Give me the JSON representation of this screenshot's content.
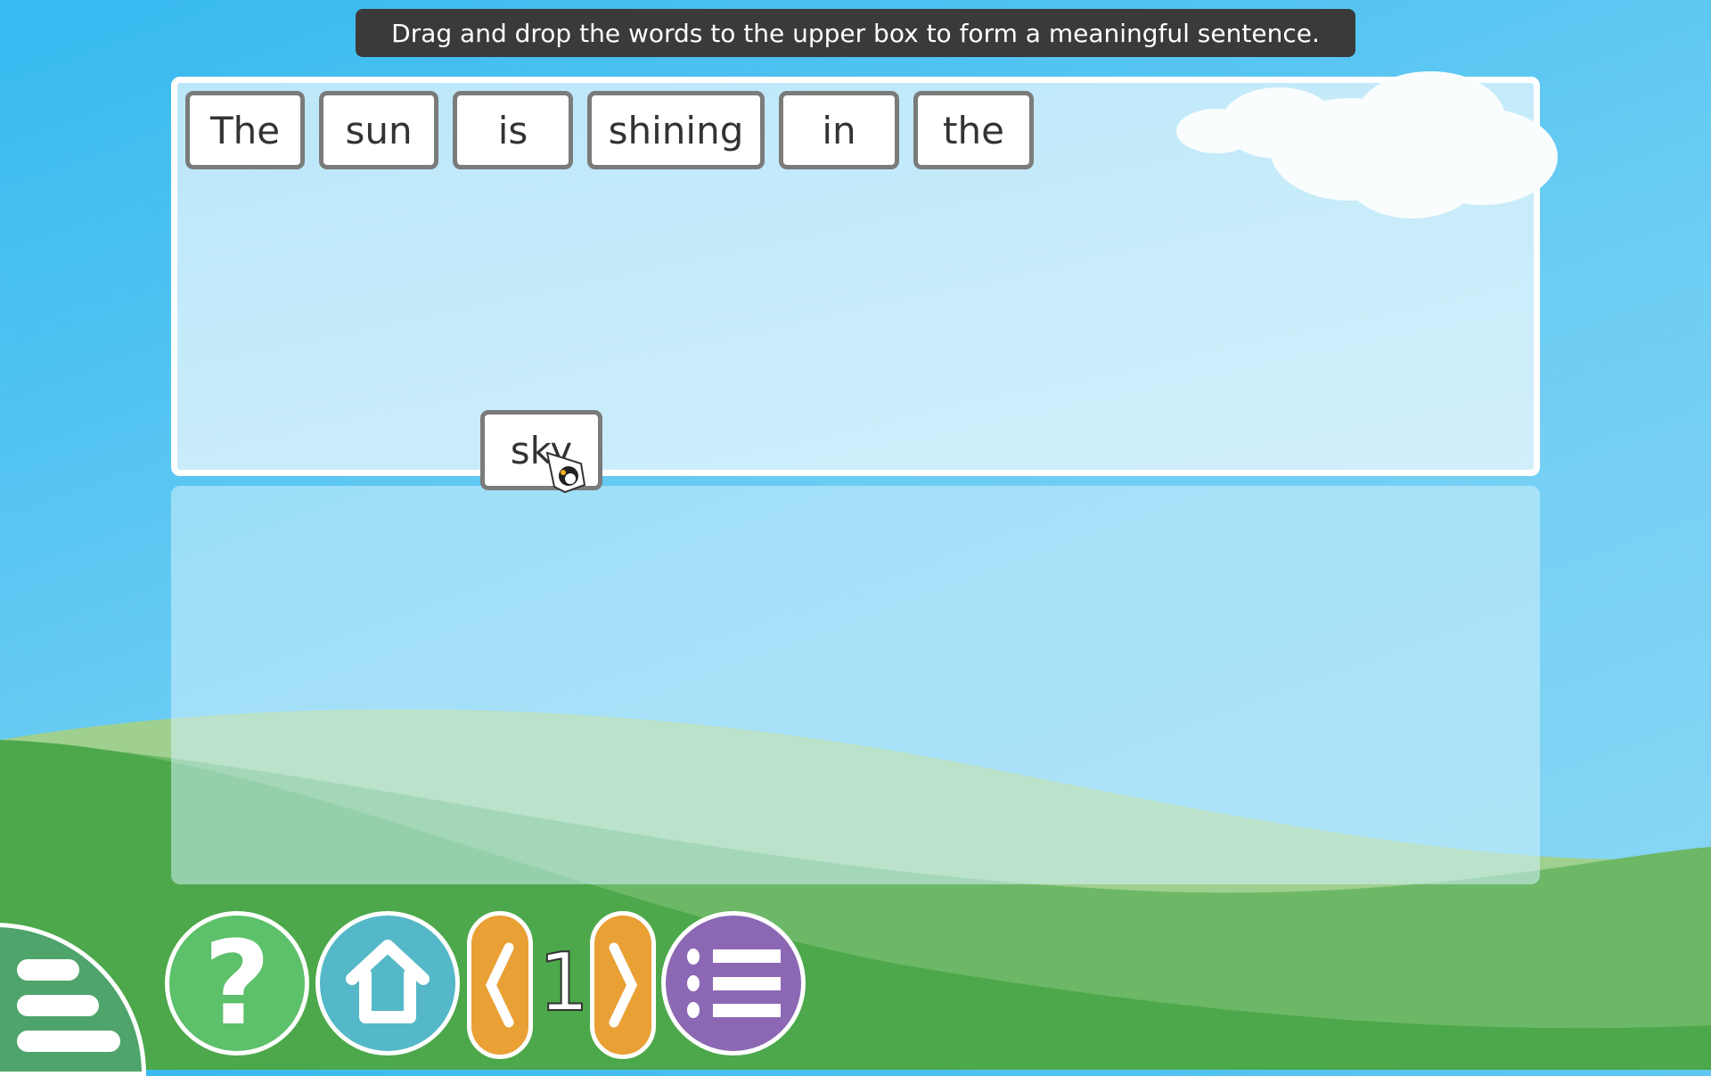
{
  "instruction": "Drag and drop the words to the upper box to form a meaningful sentence.",
  "placed_words": [
    "The",
    "sun",
    "is",
    "shining",
    "in",
    "the"
  ],
  "dragging_word": "sky",
  "page_number": "1",
  "nav": {
    "menu": "menu-icon",
    "help": "question-icon",
    "home": "home-icon",
    "prev": "chevron-left-icon",
    "next": "chevron-right-icon",
    "list": "list-icon"
  },
  "colors": {
    "help": "#5dc06a",
    "home": "#54b8c8",
    "arrows": "#e9a035",
    "list": "#8c68b4",
    "grass": "#4ca84a"
  }
}
